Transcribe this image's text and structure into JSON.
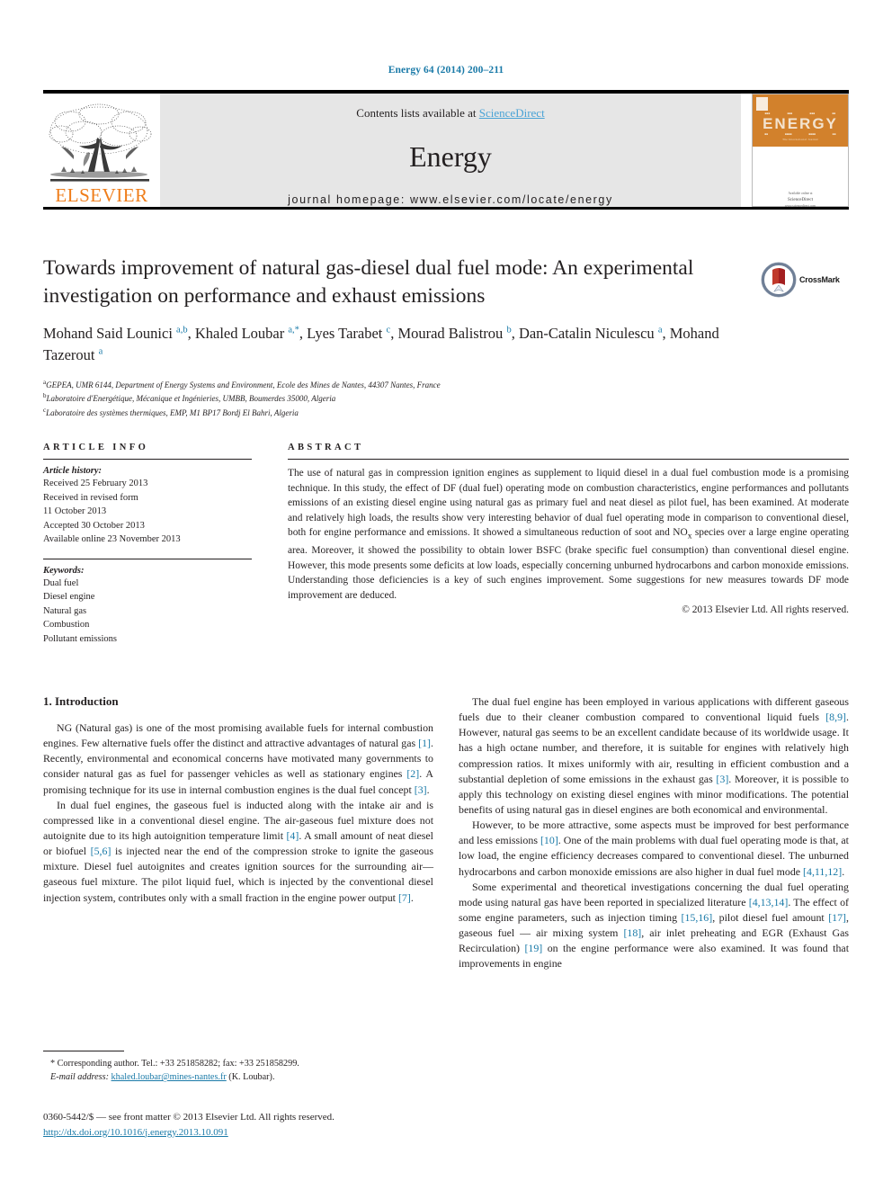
{
  "running_head": "Energy 64 (2014) 200–211",
  "masthead": {
    "contents_prefix": "Contents lists available at ",
    "sciencedirect": "ScienceDirect",
    "journal_name": "Energy",
    "homepage": "journal homepage: www.elsevier.com/locate/energy",
    "publisher_wordmark": "ELSEVIER",
    "cover": {
      "title": "ENERGY",
      "subtitle": "The International Journal",
      "footer_line1": "Available online at",
      "footer_line2": "ScienceDirect",
      "footer_line3": "www.sciencedirect.com"
    }
  },
  "article": {
    "title": "Towards improvement of natural gas-diesel dual fuel mode: An experimental investigation on performance and exhaust emissions",
    "authors_html": "Mohand Said Lounici <sup>a,b</sup>, Khaled Loubar <sup>a,*</sup>, Lyes Tarabet <sup>c</sup>, Mourad Balistrou <sup>b</sup>, Dan-Catalin Niculescu <sup>a</sup>, Mohand Tazerout <sup>a</sup>",
    "affiliations": [
      {
        "marker": "a",
        "text": "GEPEA, UMR 6144, Department of Energy Systems and Environment, Ecole des Mines de Nantes, 44307 Nantes, France"
      },
      {
        "marker": "b",
        "text": "Laboratoire d'Energétique, Mécanique et Ingénieries, UMBB, Boumerdes 35000, Algeria"
      },
      {
        "marker": "c",
        "text": "Laboratoire des systèmes thermiques, EMP, M1 BP17 Bordj El Bahri, Algeria"
      }
    ],
    "crossmark_label": "CrossMark"
  },
  "article_info": {
    "heading": "ARTICLE INFO",
    "history_label": "Article history:",
    "history": [
      "Received 25 February 2013",
      "Received in revised form",
      "11 October 2013",
      "Accepted 30 October 2013",
      "Available online 23 November 2013"
    ],
    "keywords_label": "Keywords:",
    "keywords": [
      "Dual fuel",
      "Diesel engine",
      "Natural gas",
      "Combustion",
      "Pollutant emissions"
    ]
  },
  "abstract": {
    "heading": "ABSTRACT",
    "text": "The use of natural gas in compression ignition engines as supplement to liquid diesel in a dual fuel combustion mode is a promising technique. In this study, the effect of DF (dual fuel) operating mode on combustion characteristics, engine performances and pollutants emissions of an existing diesel engine using natural gas as primary fuel and neat diesel as pilot fuel, has been examined. At moderate and relatively high loads, the results show very interesting behavior of dual fuel operating mode in comparison to conventional diesel, both for engine performance and emissions. It showed a simultaneous reduction of soot and NOx species over a large engine operating area. Moreover, it showed the possibility to obtain lower BSFC (brake specific fuel consumption) than conventional diesel engine. However, this mode presents some deficits at low loads, especially concerning unburned hydrocarbons and carbon monoxide emissions. Understanding those deficiencies is a key of such engines improvement. Some suggestions for new measures towards DF mode improvement are deduced.",
    "copyright": "© 2013 Elsevier Ltd. All rights reserved."
  },
  "body": {
    "section_title": "1. Introduction",
    "left_paragraphs": [
      "NG (Natural gas) is one of the most promising available fuels for internal combustion engines. Few alternative fuels offer the distinct and attractive advantages of natural gas [1]. Recently, environmental and economical concerns have motivated many governments to consider natural gas as fuel for passenger vehicles as well as stationary engines [2]. A promising technique for its use in internal combustion engines is the dual fuel concept [3].",
      "In dual fuel engines, the gaseous fuel is inducted along with the intake air and is compressed like in a conventional diesel engine. The air-gaseous fuel mixture does not autoignite due to its high autoignition temperature limit [4]. A small amount of neat diesel or biofuel [5,6] is injected near the end of the compression stroke to ignite the gaseous mixture. Diesel fuel autoignites and creates ignition sources for the surrounding air—gaseous fuel mixture. The pilot liquid fuel, which is injected by the conventional diesel injection system, contributes only with a small fraction in the engine power output [7]."
    ],
    "right_paragraphs": [
      "The dual fuel engine has been employed in various applications with different gaseous fuels due to their cleaner combustion compared to conventional liquid fuels [8,9]. However, natural gas seems to be an excellent candidate because of its worldwide usage. It has a high octane number, and therefore, it is suitable for engines with relatively high compression ratios. It mixes uniformly with air, resulting in efficient combustion and a substantial depletion of some emissions in the exhaust gas [3]. Moreover, it is possible to apply this technology on existing diesel engines with minor modifications. The potential benefits of using natural gas in diesel engines are both economical and environmental.",
      "However, to be more attractive, some aspects must be improved for best performance and less emissions [10]. One of the main problems with dual fuel operating mode is that, at low load, the engine efficiency decreases compared to conventional diesel. The unburned hydrocarbons and carbon monoxide emissions are also higher in dual fuel mode [4,11,12].",
      "Some experimental and theoretical investigations concerning the dual fuel operating mode using natural gas have been reported in specialized literature [4,13,14]. The effect of some engine parameters, such as injection timing [15,16], pilot diesel fuel amount [17], gaseous fuel — air mixing system [18], air inlet preheating and EGR (Exhaust Gas Recirculation) [19] on the engine performance were also examined. It was found that improvements in engine"
    ]
  },
  "footnote": {
    "corresponding": "* Corresponding author. Tel.: +33 251858282; fax: +33 251858299.",
    "email_label": "E-mail address:",
    "email": "khaled.loubar@mines-nantes.fr",
    "email_suffix": "(K. Loubar)."
  },
  "imprint": {
    "line1": "0360-5442/$ — see front matter © 2013 Elsevier Ltd. All rights reserved.",
    "doi": "http://dx.doi.org/10.1016/j.energy.2013.10.091"
  },
  "colors": {
    "link": "#1a7aa8",
    "elsevier_orange": "#ef7d1a",
    "cover_orange": "#d2812c",
    "masthead_grey": "#e6e6e6"
  }
}
